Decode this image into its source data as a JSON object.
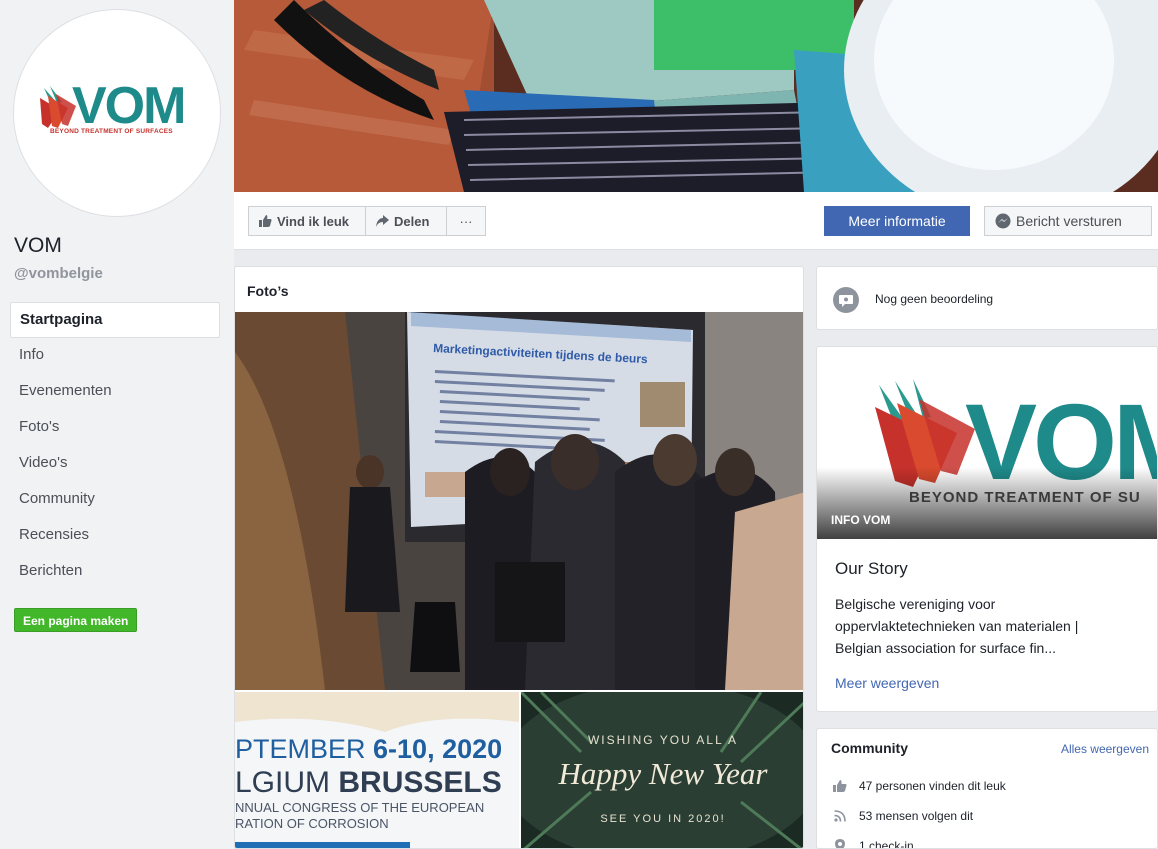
{
  "page": {
    "logo_word": "VOM",
    "logo_tagline": "BEYOND TREATMENT OF SURFACES",
    "name": "VOM",
    "handle": "@vombelgie"
  },
  "nav": {
    "items": [
      {
        "label": "Startpagina"
      },
      {
        "label": "Info"
      },
      {
        "label": "Evenementen"
      },
      {
        "label": "Foto's"
      },
      {
        "label": "Video's"
      },
      {
        "label": "Community"
      },
      {
        "label": "Recensies"
      },
      {
        "label": "Berichten"
      }
    ],
    "create_page": "Een pagina maken"
  },
  "actions": {
    "like": "Vind ik leuk",
    "share": "Delen",
    "more": "···",
    "more_info": "Meer informatie",
    "send_message": "Bericht versturen"
  },
  "photos": {
    "title": "Foto’s",
    "slide_title": "Marketingactiviteiten tijdens de beurs",
    "thumb1": {
      "line1a": "PTEMBER ",
      "line1b": "6-10, 2020",
      "line2a": "LGIUM ",
      "line2b": "BRUSSELS",
      "line3": "NNUAL CONGRESS OF THE EUROPEAN",
      "line4": "RATION OF CORROSION"
    },
    "thumb2": {
      "line1": "WISHING YOU ALL A",
      "line2": "Happy New Year",
      "line3": "SEE YOU IN 2020!"
    }
  },
  "rating": {
    "text": "Nog geen beoordeling"
  },
  "about": {
    "logo_word": "VOM",
    "logo_tagline": "BEYOND TREATMENT OF SU",
    "label": "INFO VOM",
    "story_title": "Our Story",
    "story_text": "Belgische vereniging voor oppervlaktetechnieken van materialen | Belgian association for surface fin...",
    "more": "Meer weergeven"
  },
  "community": {
    "title": "Community",
    "see_all": "Alles weergeven",
    "likes": "47 personen vinden dit leuk",
    "follows": "53 mensen volgen dit",
    "checkins": "1 check-in"
  },
  "colors": {
    "brand_blue": "#4267b2",
    "green": "#42b72a",
    "vom_teal": "#1f8a8a",
    "vom_red": "#c7312b"
  }
}
